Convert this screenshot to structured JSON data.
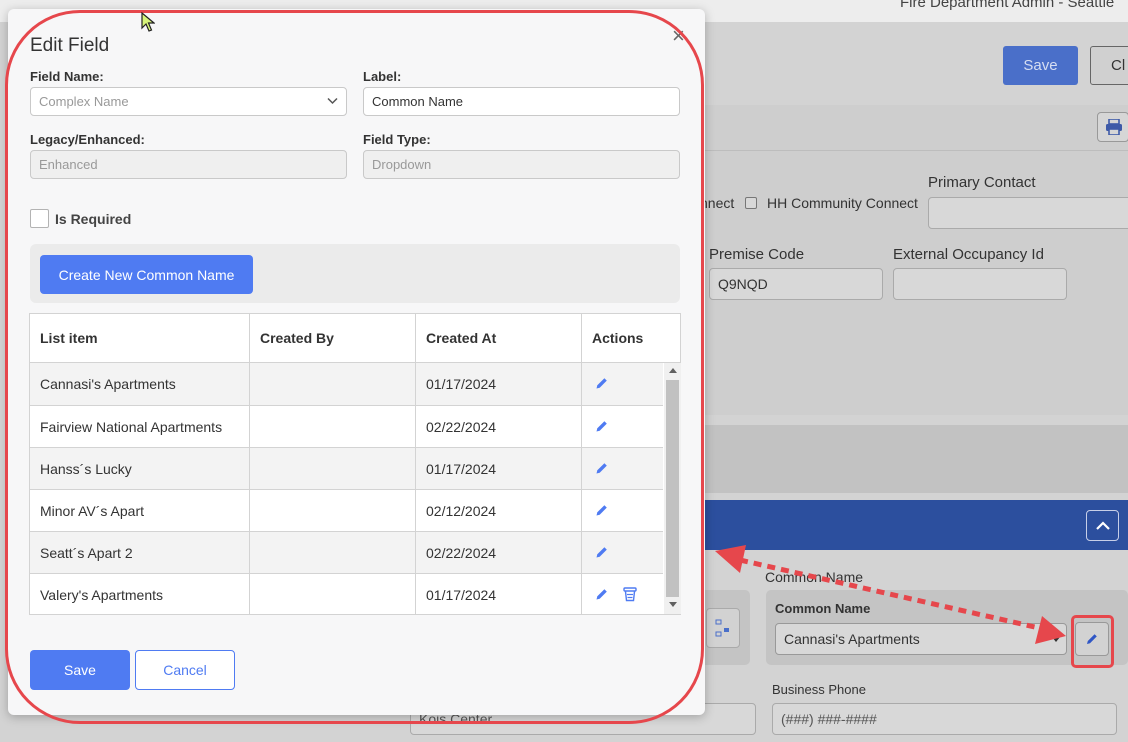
{
  "background": {
    "user_label": "Fire Department Admin - Seattle",
    "save_label": "Save",
    "close_label": "Cl",
    "checkbox_partial_label": "nnect",
    "hh_community_connect_label": "HH Community Connect",
    "primary_contact_label": "Primary Contact",
    "premise_code_label": "Premise Code",
    "premise_code_value": "Q9NQD",
    "external_occupancy_label": "External Occupancy Id",
    "common_name_heading": "Common Name",
    "common_name_label": "Common Name",
    "common_name_value": "Cannasi's Apartments",
    "business_phone_label": "Business Phone",
    "business_phone_placeholder": "(###) ###-####",
    "partial_input_value": "Kois Center"
  },
  "modal": {
    "title": "Edit Field",
    "close_glyph": "×",
    "field_name": {
      "label": "Field Name:",
      "placeholder": "Complex Name"
    },
    "label_field": {
      "label": "Label:",
      "value": "Common Name"
    },
    "legacy": {
      "label": "Legacy/Enhanced:",
      "value": "Enhanced"
    },
    "field_type": {
      "label": "Field Type:",
      "value": "Dropdown"
    },
    "is_required": {
      "label": "Is Required",
      "checked": false
    },
    "create_button": "Create New Common Name",
    "table": {
      "columns": [
        "List item",
        "Created By",
        "Created At",
        "Actions"
      ],
      "rows": [
        {
          "item": "Cannasi's Apartments",
          "created_by": "",
          "created_at": "01/17/2024",
          "deletable": false
        },
        {
          "item": "Fairview National Apartments",
          "created_by": "",
          "created_at": "02/22/2024",
          "deletable": false
        },
        {
          "item": "Hanss´s Lucky",
          "created_by": "",
          "created_at": "01/17/2024",
          "deletable": false
        },
        {
          "item": "Minor AV´s Apart",
          "created_by": "",
          "created_at": "02/12/2024",
          "deletable": false
        },
        {
          "item": "Seatt´s Apart 2",
          "created_by": "",
          "created_at": "02/22/2024",
          "deletable": false
        },
        {
          "item": "Valery's Apartments",
          "created_by": "",
          "created_at": "01/17/2024",
          "deletable": true
        }
      ]
    },
    "save_button": "Save",
    "cancel_button": "Cancel"
  },
  "colors": {
    "primary": "#4f7bf2",
    "annotation": "#e6474c",
    "header_band": "#2c4f9e"
  },
  "icons": [
    "pencil-icon",
    "trash-icon",
    "chevron-down-icon",
    "close-icon",
    "printer-icon",
    "chevron-up-icon",
    "mouse-cursor-icon"
  ]
}
